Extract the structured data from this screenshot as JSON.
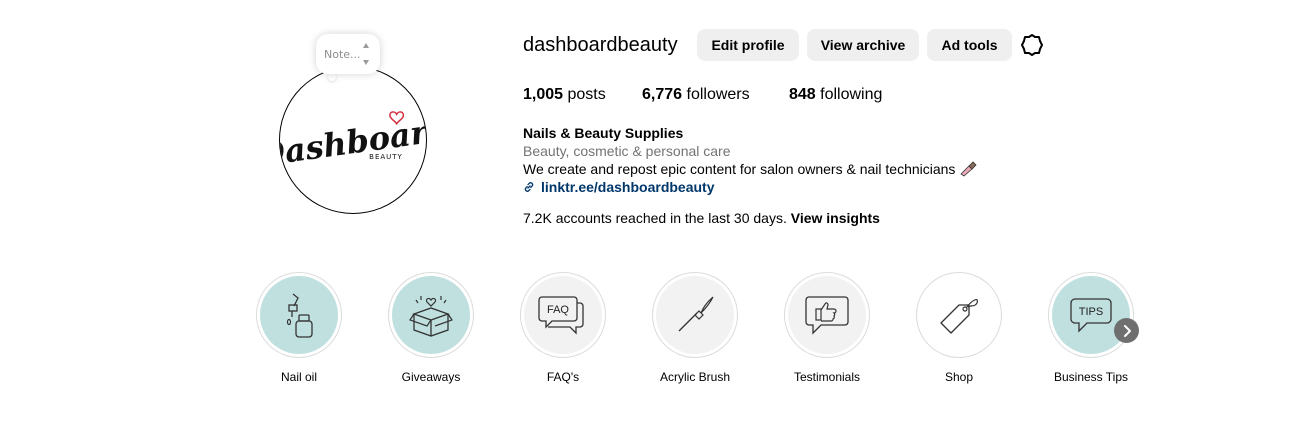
{
  "profile": {
    "username": "dashboardbeauty",
    "note_placeholder": "Note...",
    "logo_text": "Dashboard",
    "logo_subtext": "BEAUTY"
  },
  "buttons": {
    "edit_profile": "Edit profile",
    "view_archive": "View archive",
    "ad_tools": "Ad tools"
  },
  "stats": {
    "posts_count": "1,005",
    "posts_label": " posts",
    "followers_count": "6,776",
    "followers_label": " followers",
    "following_count": "848",
    "following_label": " following"
  },
  "bio": {
    "name": "Nails & Beauty Supplies",
    "category": "Beauty, cosmetic & personal care",
    "text": "We create and repost epic content for salon owners & nail technicians",
    "link": "linktr.ee/dashboardbeauty"
  },
  "insights": {
    "text": "7.2K accounts reached in the last 30 days. ",
    "action": "View insights"
  },
  "highlights": [
    {
      "label": "Nail oil",
      "icon": "nail-oil-bottle-icon",
      "bg": "#bfe0df"
    },
    {
      "label": "Giveaways",
      "icon": "gift-box-icon",
      "bg": "#bfe0df"
    },
    {
      "label": "FAQ's",
      "icon": "faq-speech-bubble-icon",
      "bg": "#f2f2f2"
    },
    {
      "label": "Acrylic Brush",
      "icon": "brush-icon",
      "bg": "#f2f2f2"
    },
    {
      "label": "Testimonials",
      "icon": "thumbs-up-bubble-icon",
      "bg": "#f2f2f2"
    },
    {
      "label": "Shop",
      "icon": "price-tag-icon",
      "bg": "#ffffff"
    },
    {
      "label": "Business Tips",
      "icon": "tips-speech-bubble-icon",
      "bg": "#bfe0df"
    }
  ],
  "highlight_icon_text": {
    "faq": "FAQ",
    "tips": "TIPS"
  },
  "colors": {
    "button_bg": "#efefef",
    "link": "#00376b",
    "secondary_text": "#737373",
    "highlight_teal": "#bfe0df"
  }
}
